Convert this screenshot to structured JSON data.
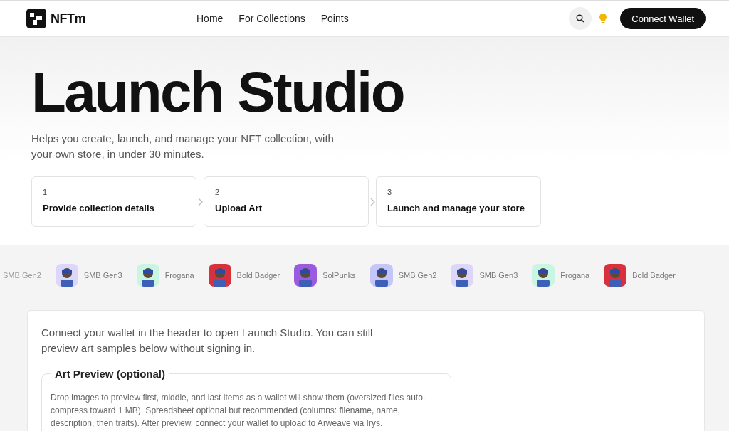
{
  "header": {
    "brand": "NFTm",
    "nav": [
      {
        "label": "Home"
      },
      {
        "label": "For Collections"
      },
      {
        "label": "Points"
      }
    ],
    "connect_button": "Connect Wallet"
  },
  "hero": {
    "title": "Launch Studio",
    "subtitle": "Helps you create, launch, and manage your NFT collection, with your own store, in under 30 minutes.",
    "steps": [
      {
        "number": "1",
        "label": "Provide collection details"
      },
      {
        "number": "2",
        "label": "Upload Art"
      },
      {
        "number": "3",
        "label": "Launch and manage your store"
      }
    ]
  },
  "collections": [
    {
      "name": "SMB Gen2",
      "kind": "label-only"
    },
    {
      "name": "SMB Gen3",
      "kind": "avatar",
      "color": "#ddd6fb"
    },
    {
      "name": "Frogana",
      "kind": "avatar",
      "color": "#c9f5e3"
    },
    {
      "name": "Bold Badger",
      "kind": "avatar",
      "color": "#d8303c"
    },
    {
      "name": "SolPunks",
      "kind": "avatar",
      "color": "#9a5be0"
    },
    {
      "name": "SMB Gen2",
      "kind": "avatar",
      "color": "#c4c6fa"
    },
    {
      "name": "SMB Gen3",
      "kind": "avatar",
      "color": "#ddd6fb"
    },
    {
      "name": "Frogana",
      "kind": "avatar",
      "color": "#c9f5e3"
    },
    {
      "name": "Bold Badger",
      "kind": "avatar",
      "color": "#d8303c"
    }
  ],
  "main": {
    "notice": "Connect your wallet in the header to open Launch Studio. You can still preview art samples below without signing in.",
    "art_preview": {
      "title": "Art Preview (optional)",
      "description": "Drop images to preview first, middle, and last items as a wallet will show them (oversized files auto-compress toward 1 MB). Spreadsheet optional but recommended (columns: filename, name, description, then traits). After preview, connect your wallet to upload to Arweave via Irys."
    }
  }
}
